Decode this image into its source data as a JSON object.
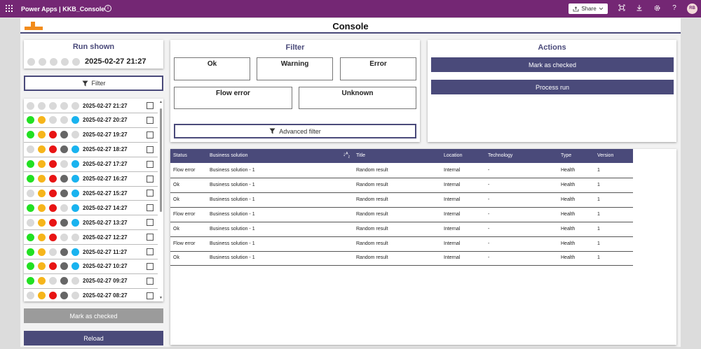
{
  "topbar": {
    "brand": "Power Apps  |  KKB_Console",
    "share_label": "Share",
    "avatar": "RB",
    "icons": [
      "waffle-icon",
      "info-icon",
      "share-icon",
      "chevron-down-icon",
      "fit-icon",
      "download-icon",
      "gear-icon",
      "help-icon"
    ]
  },
  "header": {
    "title": "Console"
  },
  "run_shown": {
    "title": "Run shown",
    "timestamp": "2025-02-27 21:27",
    "dots": [
      "off",
      "off",
      "off",
      "off",
      "off"
    ]
  },
  "filter_button": {
    "label": "Filter"
  },
  "runs": [
    {
      "ts": "2025-02-27 21:27",
      "dots": [
        "off",
        "off",
        "off",
        "off",
        "off"
      ]
    },
    {
      "ts": "2025-02-27 20:27",
      "dots": [
        "green",
        "yellow",
        "off",
        "off",
        "blue"
      ]
    },
    {
      "ts": "2025-02-27 19:27",
      "dots": [
        "green",
        "yellow",
        "red",
        "gray",
        "off"
      ]
    },
    {
      "ts": "2025-02-27 18:27",
      "dots": [
        "off",
        "yellow",
        "red",
        "gray",
        "blue"
      ]
    },
    {
      "ts": "2025-02-27 17:27",
      "dots": [
        "green",
        "yellow",
        "red",
        "off",
        "blue"
      ]
    },
    {
      "ts": "2025-02-27 16:27",
      "dots": [
        "green",
        "yellow",
        "red",
        "gray",
        "blue"
      ]
    },
    {
      "ts": "2025-02-27 15:27",
      "dots": [
        "off",
        "yellow",
        "red",
        "gray",
        "blue"
      ]
    },
    {
      "ts": "2025-02-27 14:27",
      "dots": [
        "green",
        "yellow",
        "red",
        "off",
        "blue"
      ]
    },
    {
      "ts": "2025-02-27 13:27",
      "dots": [
        "off",
        "yellow",
        "red",
        "gray",
        "blue"
      ]
    },
    {
      "ts": "2025-02-27 12:27",
      "dots": [
        "green",
        "yellow",
        "red",
        "off",
        "off"
      ]
    },
    {
      "ts": "2025-02-27 11:27",
      "dots": [
        "green",
        "yellow",
        "off",
        "gray",
        "blue"
      ]
    },
    {
      "ts": "2025-02-27 10:27",
      "dots": [
        "green",
        "yellow",
        "red",
        "gray",
        "blue"
      ]
    },
    {
      "ts": "2025-02-27 09:27",
      "dots": [
        "green",
        "yellow",
        "off",
        "gray",
        "off"
      ]
    },
    {
      "ts": "2025-02-27 08:27",
      "dots": [
        "off",
        "yellow",
        "red",
        "gray",
        "off"
      ]
    }
  ],
  "left_buttons": {
    "mark_checked": "Mark as checked",
    "reload": "Reload"
  },
  "filter_card": {
    "title": "Filter",
    "options": [
      "Ok",
      "Warning",
      "Error",
      "Flow error",
      "Unknown"
    ],
    "advanced": "Advanced filter"
  },
  "actions": {
    "title": "Actions",
    "mark_checked": "Mark as checked",
    "process_run": "Process run"
  },
  "table": {
    "columns": [
      "Status",
      "Business solution",
      "Title",
      "Location",
      "Technology",
      "Type",
      "Version"
    ],
    "sort_icon": "sort-az-icon",
    "rows": [
      [
        "Flow error",
        "Business solution - 1",
        "Random result",
        "Internal",
        "-",
        "Health",
        "1"
      ],
      [
        "Ok",
        "Business solution - 1",
        "Random result",
        "Internal",
        "-",
        "Health",
        "1"
      ],
      [
        "Ok",
        "Business solution - 1",
        "Random result",
        "Internal",
        "-",
        "Health",
        "1"
      ],
      [
        "Flow error",
        "Business solution - 1",
        "Random result",
        "Internal",
        "-",
        "Health",
        "1"
      ],
      [
        "Ok",
        "Business solution - 1",
        "Random result",
        "Internal",
        "-",
        "Health",
        "1"
      ],
      [
        "Flow error",
        "Business solution - 1",
        "Random result",
        "Internal",
        "-",
        "Health",
        "1"
      ],
      [
        "Ok",
        "Business solution - 1",
        "Random result",
        "Internal",
        "-",
        "Health",
        "1"
      ]
    ]
  },
  "colors": {
    "topbar": "#742774",
    "accent": "#4a4a7a",
    "logo": "#f28c1b"
  }
}
